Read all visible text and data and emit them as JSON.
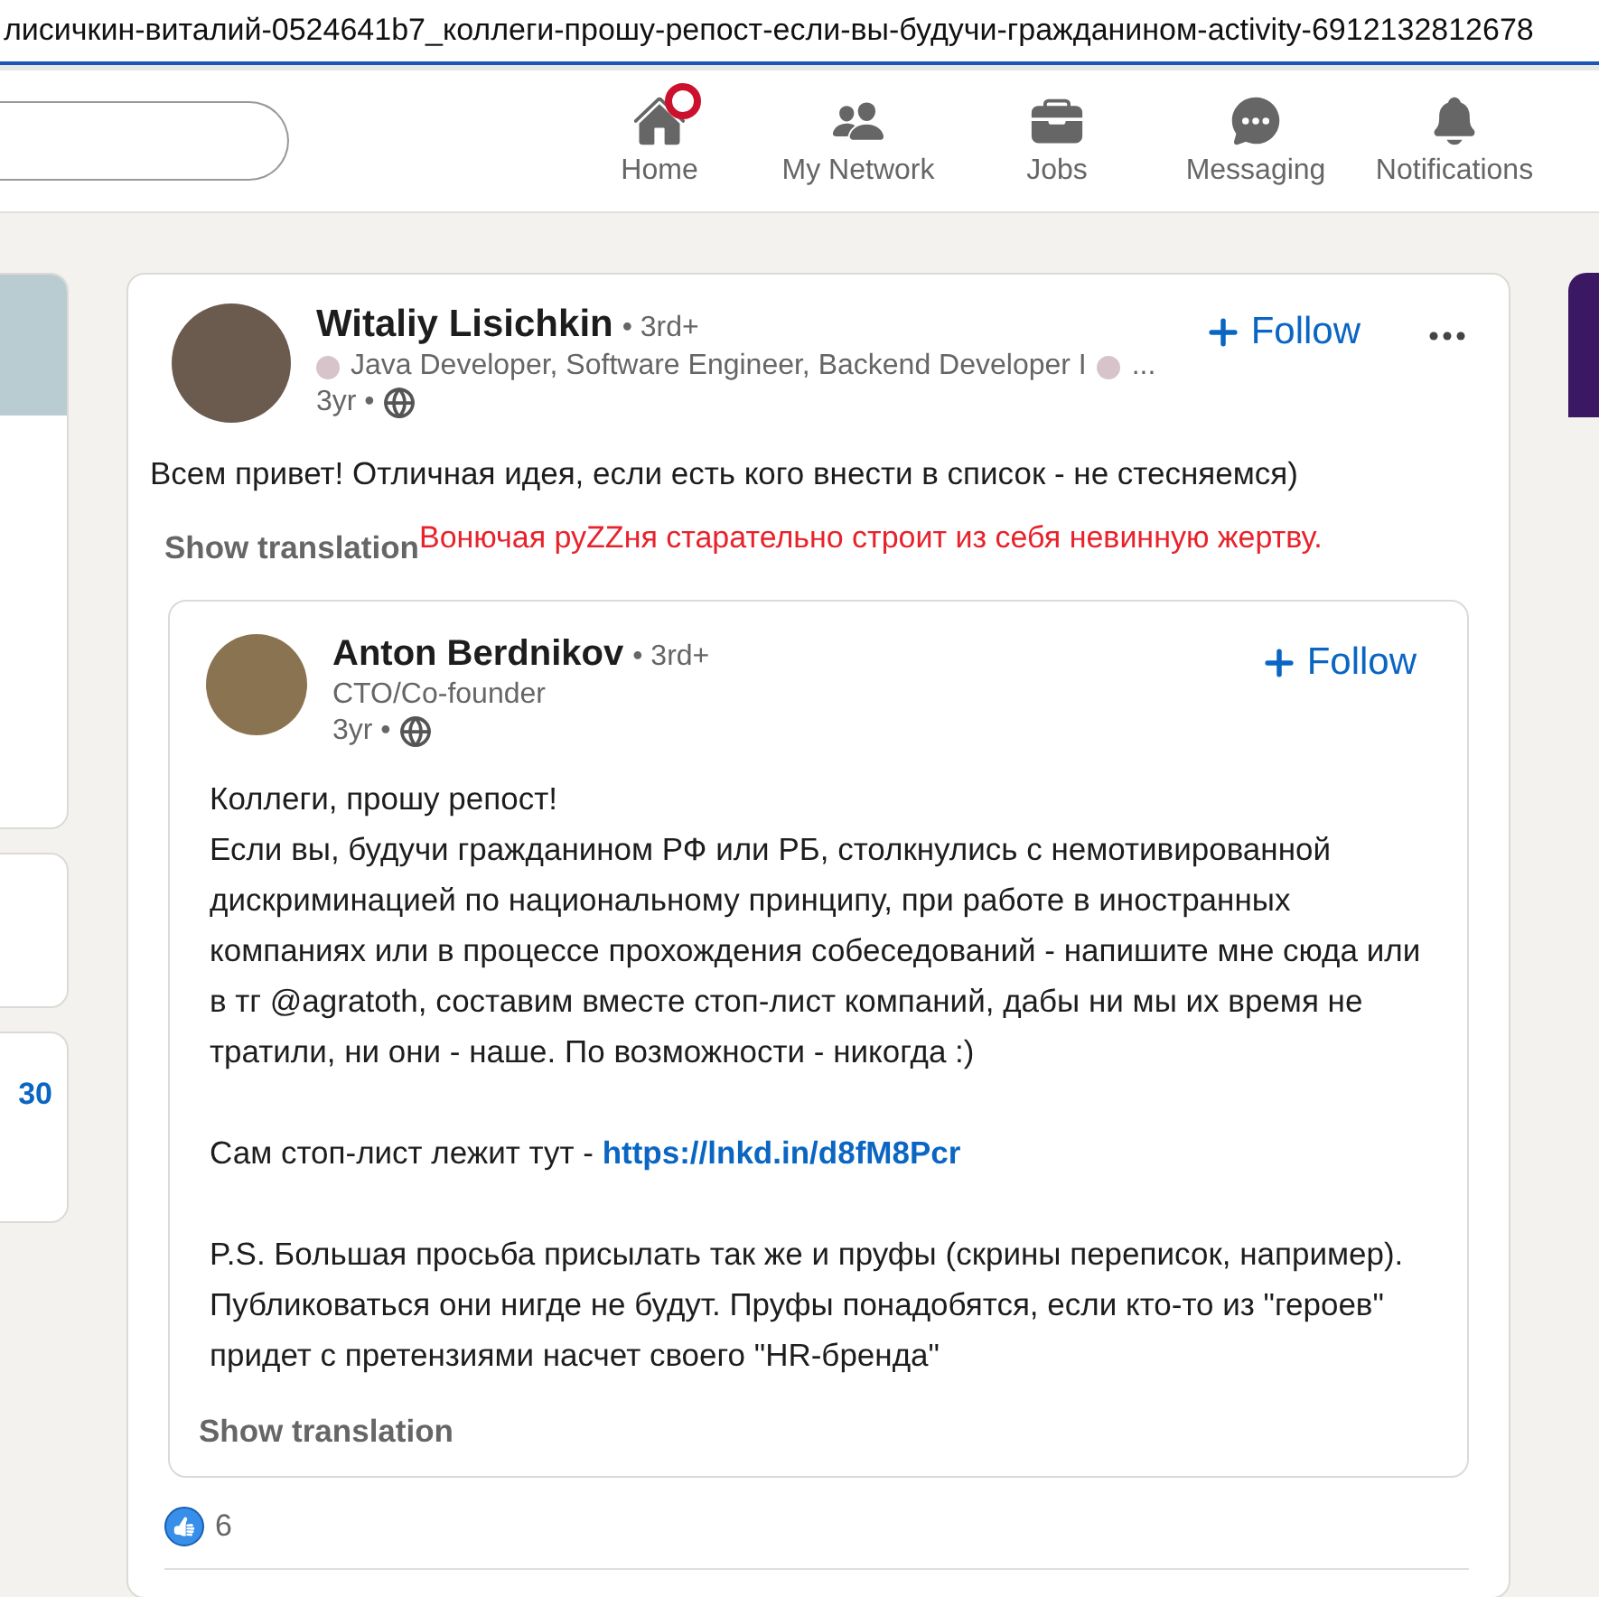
{
  "address_bar": {
    "url": "лисичкин-виталий-0524641b7_коллеги-прошу-репост-если-вы-будучи-гражданином-activity-6912132812678"
  },
  "nav": {
    "items": [
      {
        "kind": "home",
        "label": "Home",
        "notified": true
      },
      {
        "kind": "network",
        "label": "My Network",
        "notified": false
      },
      {
        "kind": "jobs",
        "label": "Jobs",
        "notified": false
      },
      {
        "kind": "messaging",
        "label": "Messaging",
        "notified": false
      },
      {
        "kind": "notifications",
        "label": "Notifications",
        "notified": false
      }
    ]
  },
  "left_cards": [
    {
      "kind": "profile"
    },
    {
      "kind": "plain"
    },
    {
      "kind": "stat",
      "text": "30"
    }
  ],
  "post": {
    "author": "Witaliy Lisichkin",
    "degree": "• 3rd+",
    "headline": "Java Developer, Software Engineer, Backend Developer I",
    "headline_more": "...",
    "time": "3yr •",
    "follow": "Follow",
    "text": "Всем привет! Отличная идея, если есть кого внести в список - не стесняемся)",
    "show_translation": "Show translation",
    "overlay_note": "Вонючая руZZня старательно строит из себя невинную жертву.",
    "shared": {
      "author": "Anton Berdnikov",
      "degree": "• 3rd+",
      "headline": "CTO/Co-founder",
      "time": "3yr •",
      "follow": "Follow",
      "paragraphs": [
        {
          "text": "Коллеги, прошу репост!\nЕсли вы, будучи гражданином РФ или РБ, столкнулись с немотивированной дискриминацией по национальному принципу, при работе в иностранных компаниях или в процессе прохождения собеседований - напишите мне сюда или в тг @agratoth, составим вместе стоп-лист компаний, дабы ни мы их время не тратили, ни они - наше. По возможности - никогда :)"
        },
        {
          "text": "Сам стоп-лист лежит тут - ",
          "link": "https://lnkd.in/d8fM8Pcr"
        },
        {
          "text": "P.S. Большая просьба присылать так же и пруфы (скрины переписок, например). Публиковаться они нигде не будут. Пруфы понадобятся, если кто-то из \"героев\" придет с претензиями насчет своего \"HR-бренда\""
        }
      ],
      "show_translation": "Show translation"
    },
    "reactions": "6"
  }
}
